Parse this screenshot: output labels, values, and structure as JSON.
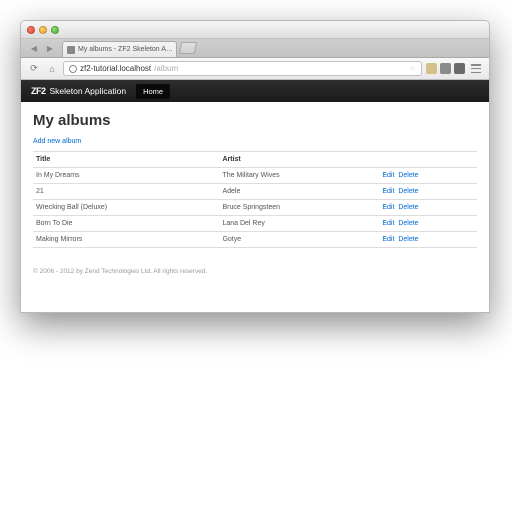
{
  "window": {
    "tab_title": "My albums - ZF2 Skeleton A…"
  },
  "address": {
    "domain": "zf2-tutorial.localhost",
    "path": "/album"
  },
  "navbar": {
    "brand_prefix": "ZF2",
    "brand_text": "Skeleton Application",
    "link_home": "Home"
  },
  "page": {
    "heading": "My albums",
    "add_link": "Add new album"
  },
  "table": {
    "headers": {
      "title": "Title",
      "artist": "Artist",
      "actions": ""
    },
    "actions": {
      "edit": "Edit",
      "delete": "Delete"
    },
    "rows": [
      {
        "title": "In My Dreams",
        "artist": "The Military Wives"
      },
      {
        "title": "21",
        "artist": "Adele"
      },
      {
        "title": "Wrecking Ball (Deluxe)",
        "artist": "Bruce Springsteen"
      },
      {
        "title": "Born To Die",
        "artist": "Lana Del Rey"
      },
      {
        "title": "Making Mirrors",
        "artist": "Gotye"
      }
    ]
  },
  "footer": {
    "text": "© 2006 - 2012 by Zend Technologies Ltd. All rights reserved."
  }
}
